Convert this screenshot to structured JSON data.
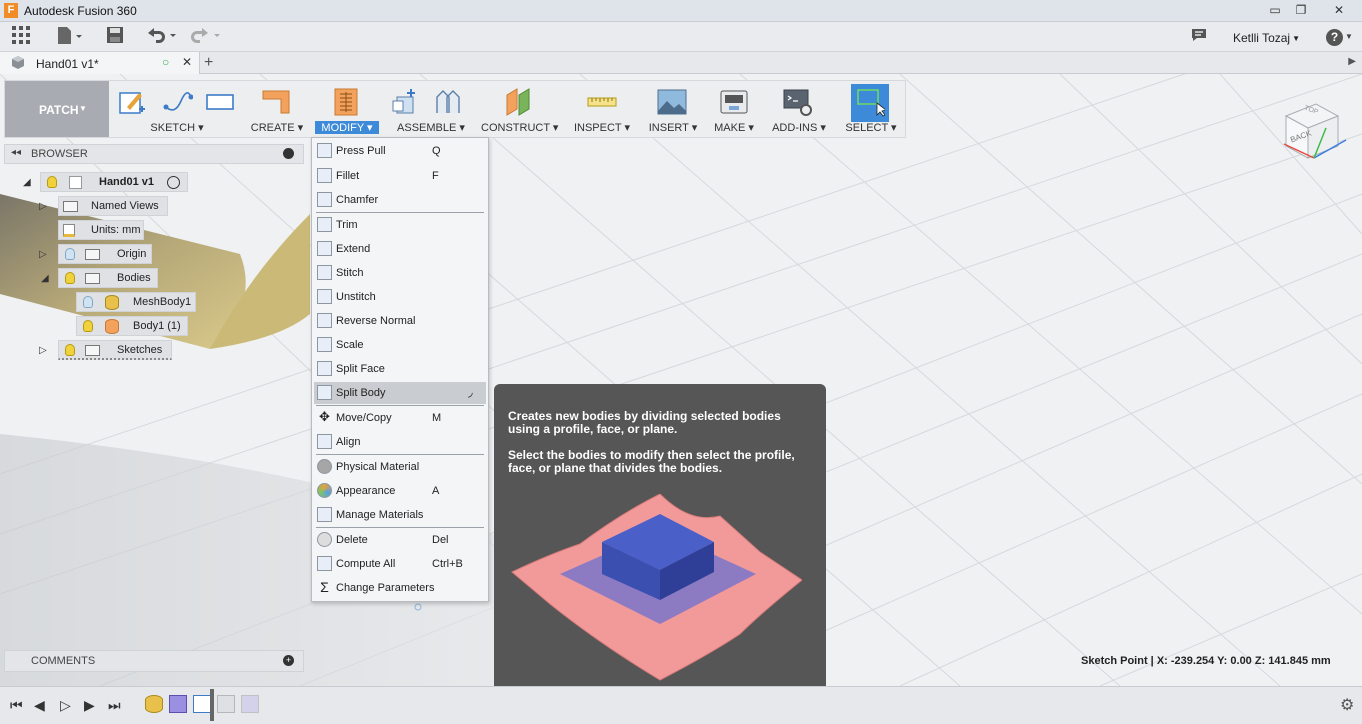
{
  "window": {
    "title": "Autodesk Fusion 360",
    "logo_letter": "F",
    "minimize": "▭",
    "restore": "❐",
    "close": "✕"
  },
  "quick_access": {
    "user_name": "Ketlli Tozaj",
    "help": "?"
  },
  "document_tab": {
    "name": "Hand01 v1*"
  },
  "toolbar": {
    "workspace": "PATCH",
    "groups": {
      "sketch": "SKETCH",
      "create": "CREATE",
      "modify": "MODIFY",
      "assemble": "ASSEMBLE",
      "construct": "CONSTRUCT",
      "inspect": "INSPECT",
      "insert": "INSERT",
      "make": "MAKE",
      "addins": "ADD-INS",
      "select": "SELECT"
    }
  },
  "browser": {
    "title": "BROWSER",
    "root": "Hand01 v1",
    "items": {
      "named_views": "Named Views",
      "units": "Units: mm",
      "origin": "Origin",
      "bodies": "Bodies",
      "meshbody": "MeshBody1",
      "body1": "Body1 (1)",
      "sketches": "Sketches"
    }
  },
  "modify_menu": {
    "items": [
      {
        "label": "Press Pull",
        "shortcut": "Q"
      },
      {
        "label": "Fillet",
        "shortcut": "F"
      },
      {
        "label": "Chamfer",
        "shortcut": ""
      },
      {
        "label": "Trim",
        "shortcut": ""
      },
      {
        "label": "Extend",
        "shortcut": ""
      },
      {
        "label": "Stitch",
        "shortcut": ""
      },
      {
        "label": "Unstitch",
        "shortcut": ""
      },
      {
        "label": "Reverse Normal",
        "shortcut": ""
      },
      {
        "label": "Scale",
        "shortcut": ""
      },
      {
        "label": "Split Face",
        "shortcut": ""
      },
      {
        "label": "Split Body",
        "shortcut": ""
      },
      {
        "label": "Move/Copy",
        "shortcut": "M"
      },
      {
        "label": "Align",
        "shortcut": ""
      },
      {
        "label": "Physical Material",
        "shortcut": ""
      },
      {
        "label": "Appearance",
        "shortcut": "A"
      },
      {
        "label": "Manage Materials",
        "shortcut": ""
      },
      {
        "label": "Delete",
        "shortcut": "Del"
      },
      {
        "label": "Compute All",
        "shortcut": "Ctrl+B"
      },
      {
        "label": "Change Parameters",
        "shortcut": ""
      }
    ]
  },
  "tooltip": {
    "line1": "Creates new bodies by dividing selected bodies using a profile, face, or plane.",
    "line2": "Select the bodies to modify then select the profile, face, or plane that divides the bodies."
  },
  "comments": {
    "title": "COMMENTS"
  },
  "status": {
    "readout": "Sketch Point | X: -239.254 Y: 0.00 Z: 141.845 mm"
  },
  "viewcube": {
    "face": "BACK",
    "top": "TOP"
  },
  "colors": {
    "accent": "#3d8ad8",
    "tooltip_bg": "#565656",
    "workspace_bg": "#a8acb2"
  }
}
